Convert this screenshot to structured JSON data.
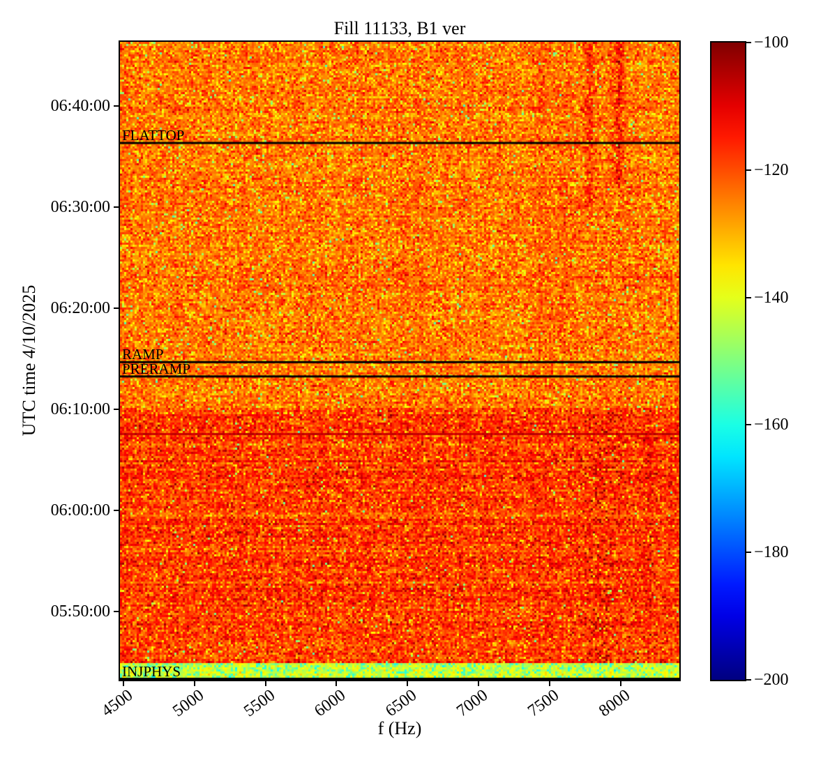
{
  "chart_data": {
    "type": "heatmap",
    "subtype": "spectrogram",
    "title": "Fill 11133, B1 ver",
    "xlabel": "f (Hz)",
    "ylabel": "UTC time 4/10/2025",
    "date": "4/10/2025",
    "noise_seed": 11133,
    "x_axis": {
      "min": 4475,
      "max": 8415,
      "ticks": [
        4500,
        5000,
        5500,
        6000,
        6500,
        7000,
        7500,
        8000
      ],
      "tick_rotation_deg": 36
    },
    "y_axis": {
      "top_time": "06:46:20",
      "bottom_time": "05:43:15",
      "ticks": [
        "06:40:00",
        "06:30:00",
        "06:20:00",
        "06:10:00",
        "06:00:00",
        "05:50:00"
      ]
    },
    "colorbar": {
      "colormap": "jet",
      "min": -200,
      "max": -100,
      "tick_labels": [
        "−100",
        "−120",
        "−140",
        "−160",
        "−180",
        "−200"
      ]
    },
    "annotations": [
      {
        "label": "FLATTOP",
        "time": "06:36:20",
        "line_color": "#000000"
      },
      {
        "label": "RAMP",
        "time": "06:14:40",
        "line_color": "#000000"
      },
      {
        "label": "PRERAMP",
        "time": "06:13:15",
        "line_color": "#000000"
      },
      {
        "label": "INJPHYS",
        "time": "05:43:20",
        "line_color": "#000000"
      }
    ],
    "regions": [
      {
        "name": "upper",
        "from": "06:46:20",
        "to": "06:10:05",
        "mean_db": -123.5,
        "sigma_db": 5.2,
        "row_sigma_db": 1.2,
        "green_speckle_prob": 0.01,
        "cyan_speckle_prob": 0
      },
      {
        "name": "hot",
        "from": "06:10:05",
        "to": "05:45:00",
        "mean_db": -117.5,
        "sigma_db": 5.2,
        "row_sigma_db": 1.8,
        "green_speckle_prob": 0.006,
        "cyan_speckle_prob": 0
      },
      {
        "name": "injphys",
        "from": "05:45:00",
        "to": "05:43:15",
        "mean_db": -141.5,
        "sigma_db": 3.5,
        "row_sigma_db": 0.8,
        "green_speckle_prob": 0,
        "cyan_speckle_prob": 0.16
      }
    ],
    "features": {
      "hline": {
        "time": "06:07:30",
        "value_db": -107
      },
      "vstreaks": [
        {
          "freq": 7780,
          "from": "06:46:20",
          "to": "06:30:00",
          "amp": 7
        },
        {
          "freq": 7990,
          "from": "06:46:20",
          "to": "06:32:00",
          "amp": 8
        },
        {
          "freq": 7600,
          "from": "06:46:20",
          "to": "06:14:40",
          "amp": 3
        },
        {
          "freq": 7440,
          "from": "06:46:20",
          "to": "06:14:40",
          "amp": 2.5
        },
        {
          "freq": 8200,
          "from": "06:08:00",
          "to": "05:45:00",
          "amp": 3.5
        },
        {
          "freq": 6450,
          "from": "06:42:00",
          "to": "06:16:00",
          "amp": 2
        }
      ],
      "dash_cluster": {
        "f_center": 7860,
        "f_sigma": 100,
        "from": "06:09:40",
        "to": "05:45:00",
        "prob": 0.11,
        "value_db": -103.5
      },
      "sparse_dash_prob": 0.0025
    }
  }
}
